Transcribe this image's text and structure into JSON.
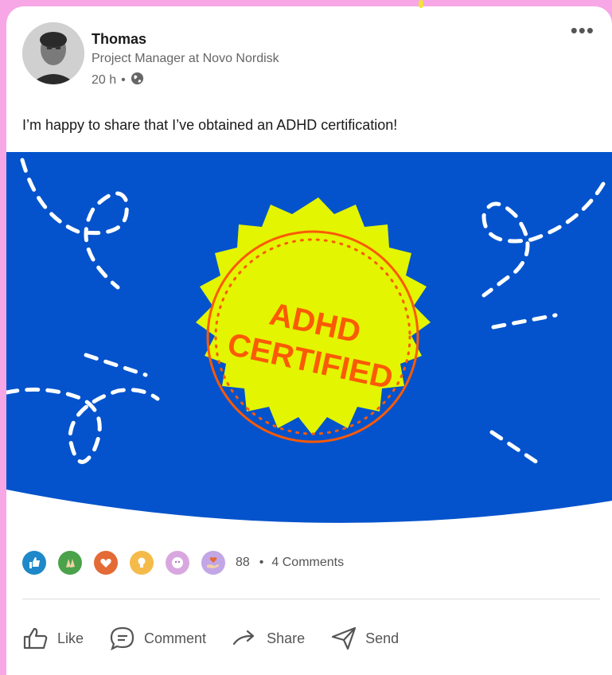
{
  "post": {
    "author_name": "Thomas",
    "author_title": "Project Manager at Novo Nordisk",
    "time": "20 h",
    "visibility_icon": "globe-icon",
    "text": "I’m happy to share that I’ve obtained an ADHD certification!",
    "more_icon": "more-options-icon"
  },
  "banner": {
    "badge_line1": "ADHD",
    "badge_line2": "CERTIFIED",
    "colors": {
      "background": "#0453cc",
      "badge": "#e3f500",
      "badge_text": "#fb5a06",
      "dashes": "#ffffff"
    }
  },
  "reactions": {
    "icons": [
      "like-reaction-icon",
      "celebrate-reaction-icon",
      "love-reaction-icon",
      "insightful-reaction-icon",
      "curious-reaction-icon",
      "support-reaction-icon"
    ],
    "count": "88",
    "separator": "•",
    "comments": "4 Comments"
  },
  "actions": {
    "like": "Like",
    "comment": "Comment",
    "share": "Share",
    "send": "Send"
  }
}
